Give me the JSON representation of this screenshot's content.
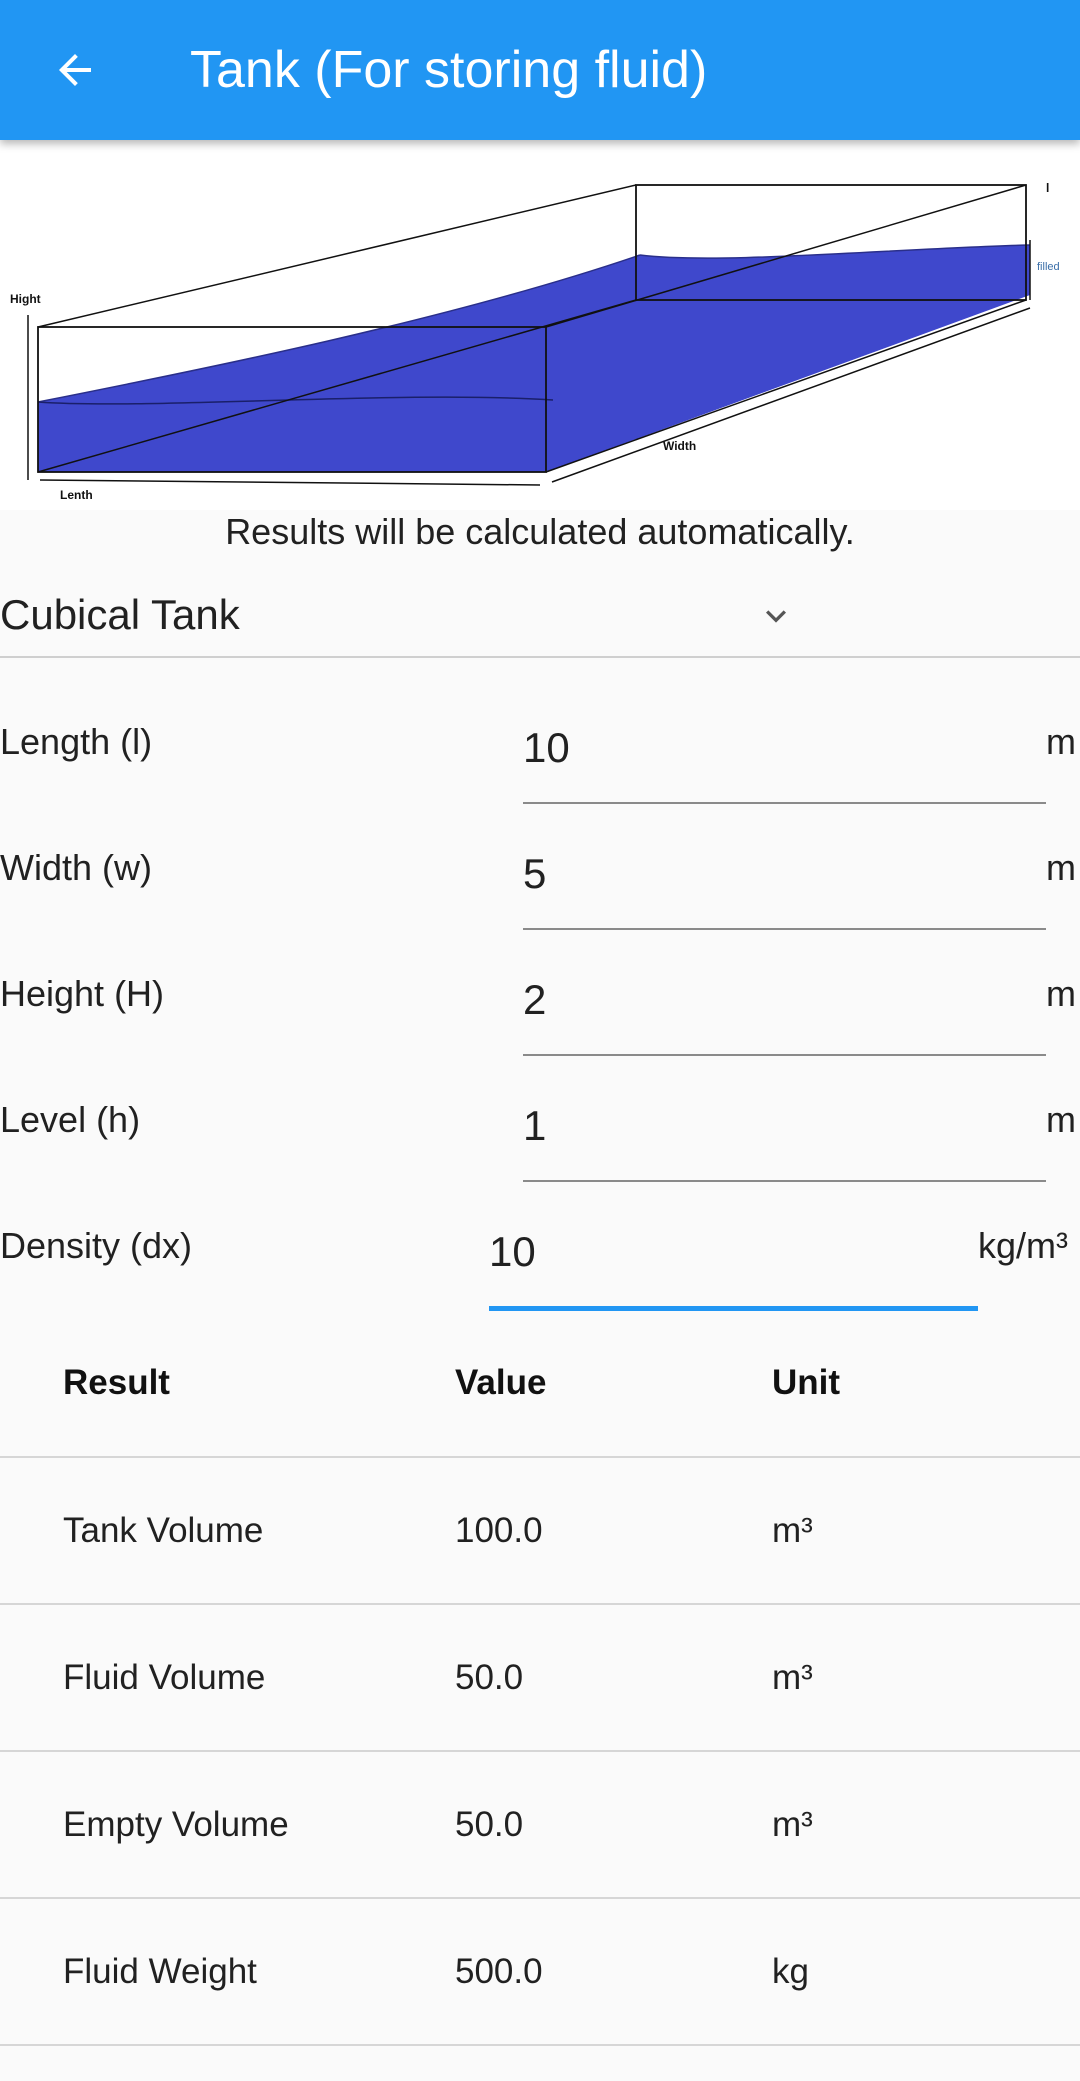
{
  "appbar": {
    "title": "Tank (For storing fluid)",
    "back_icon": "arrow-back-icon"
  },
  "diagram": {
    "labels": {
      "hight": "Hight",
      "lenth": "Lenth",
      "width": "Width",
      "filled": "filled",
      "l": "l"
    },
    "fluid_color": "#3f48cc"
  },
  "hint": "Results will be calculated automatically.",
  "tank_type": {
    "value": "Cubical Tank",
    "icon": "chevron-down-icon"
  },
  "fields": [
    {
      "label": "Length (l)",
      "value": "10",
      "unit": "m"
    },
    {
      "label": "Width (w)",
      "value": "5",
      "unit": "m"
    },
    {
      "label": "Height (H)",
      "value": "2",
      "unit": "m"
    },
    {
      "label": "Level (h)",
      "value": "1",
      "unit": "m"
    },
    {
      "label": "Density (dx)",
      "value": "10",
      "unit": "kg/m³"
    }
  ],
  "table": {
    "headers": [
      "Result",
      "Value",
      "Unit"
    ],
    "rows": [
      [
        "Tank Volume",
        "100.0",
        "m³"
      ],
      [
        "Fluid Volume",
        "50.0",
        "m³"
      ],
      [
        "Empty Volume",
        "50.0",
        "m³"
      ],
      [
        "Fluid Weight",
        "500.0",
        "kg"
      ]
    ]
  },
  "colors": {
    "primary": "#2196f3",
    "background": "#fafafa"
  }
}
